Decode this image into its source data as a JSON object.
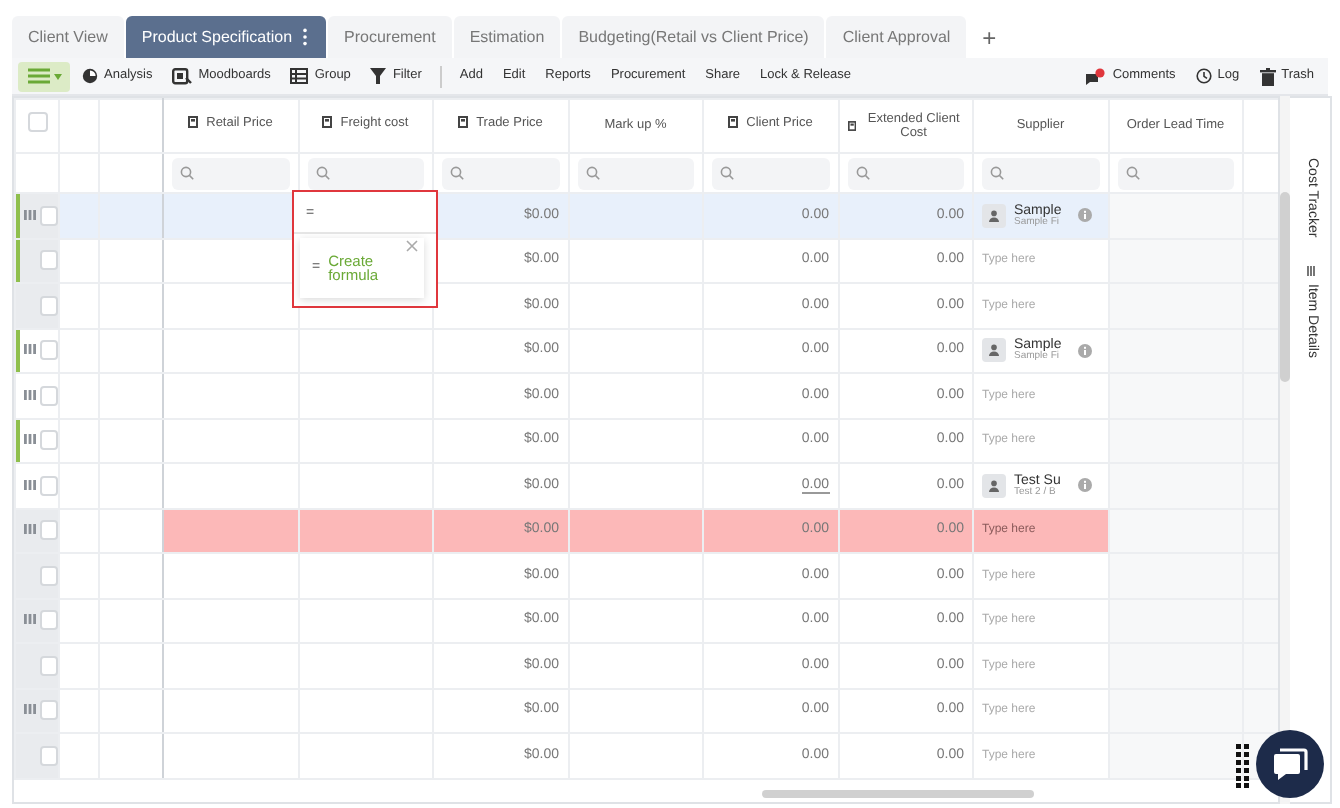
{
  "tabs": [
    {
      "label": "Client View",
      "selected": false,
      "menu": false
    },
    {
      "label": "Product Specification",
      "selected": true,
      "menu": true
    },
    {
      "label": "Procurement",
      "selected": false,
      "menu": false
    },
    {
      "label": "Estimation",
      "selected": false,
      "menu": false
    },
    {
      "label": "Budgeting(Retail vs Client Price)",
      "selected": false,
      "menu": false
    },
    {
      "label": "Client Approval",
      "selected": false,
      "menu": false
    }
  ],
  "add_tab": "+",
  "toolbar": {
    "left": [
      {
        "label": "Analysis",
        "kind": "analysis"
      },
      {
        "label": "Moodboards",
        "kind": "moodboards"
      },
      {
        "label": "Group",
        "kind": "group"
      },
      {
        "label": "Filter",
        "kind": "filter"
      }
    ],
    "actions": [
      "Add",
      "Edit",
      "Reports",
      "Procurement",
      "Share",
      "Lock & Release"
    ],
    "right": [
      {
        "label": "Comments",
        "kind": "comments"
      },
      {
        "label": "Log",
        "kind": "log"
      },
      {
        "label": "Trash",
        "kind": "trash"
      }
    ]
  },
  "select_all": {
    "checked": false
  },
  "columns": [
    {
      "label": "Retail Price",
      "icon": true
    },
    {
      "label": "Freight cost",
      "icon": true
    },
    {
      "label": "Trade Price",
      "icon": true
    },
    {
      "label": "Mark up %",
      "icon": false
    },
    {
      "label": "Client Price",
      "icon": true
    },
    {
      "label": "Extended Client Cost",
      "icon": true
    },
    {
      "label": "Supplier",
      "icon": false
    },
    {
      "label": "Order Lead Time",
      "icon": false
    }
  ],
  "rows": [
    {
      "grip": true,
      "shaded": true,
      "marked": true,
      "selected": true,
      "error": false,
      "trade_price": "$0.00",
      "client_price": "0.00",
      "client_price_underlined": false,
      "extended_cost": "0.00",
      "supplier": {
        "name": "Sample",
        "detail": "Sample Fi"
      }
    },
    {
      "grip": false,
      "shaded": true,
      "marked": true,
      "selected": false,
      "error": false,
      "trade_price": "$0.00",
      "client_price": "0.00",
      "client_price_underlined": false,
      "extended_cost": "0.00",
      "supplier": {
        "placeholder": "Type here"
      }
    },
    {
      "grip": false,
      "shaded": true,
      "marked": false,
      "selected": false,
      "error": false,
      "trade_price": "$0.00",
      "client_price": "0.00",
      "client_price_underlined": false,
      "extended_cost": "0.00",
      "supplier": {
        "placeholder": "Type here"
      }
    },
    {
      "grip": true,
      "shaded": false,
      "marked": true,
      "selected": false,
      "error": false,
      "trade_price": "$0.00",
      "client_price": "0.00",
      "client_price_underlined": false,
      "extended_cost": "0.00",
      "supplier": {
        "name": "Sample",
        "detail": "Sample Fi"
      }
    },
    {
      "grip": true,
      "shaded": false,
      "marked": false,
      "selected": false,
      "error": false,
      "trade_price": "$0.00",
      "client_price": "0.00",
      "client_price_underlined": false,
      "extended_cost": "0.00",
      "supplier": {
        "placeholder": "Type here"
      }
    },
    {
      "grip": true,
      "shaded": false,
      "marked": true,
      "selected": false,
      "error": false,
      "trade_price": "$0.00",
      "client_price": "0.00",
      "client_price_underlined": false,
      "extended_cost": "0.00",
      "supplier": {
        "placeholder": "Type here"
      }
    },
    {
      "grip": true,
      "shaded": false,
      "marked": false,
      "selected": false,
      "error": false,
      "trade_price": "$0.00",
      "client_price": "0.00",
      "client_price_underlined": true,
      "extended_cost": "0.00",
      "supplier": {
        "name": "Test Su",
        "detail": "Test 2 / B"
      }
    },
    {
      "grip": true,
      "shaded": true,
      "marked": false,
      "selected": false,
      "error": true,
      "trade_price": "$0.00",
      "client_price": "0.00",
      "client_price_underlined": false,
      "extended_cost": "0.00",
      "supplier": {
        "placeholder": "Type here"
      }
    },
    {
      "grip": false,
      "shaded": true,
      "marked": false,
      "selected": false,
      "error": false,
      "trade_price": "$0.00",
      "client_price": "0.00",
      "client_price_underlined": false,
      "extended_cost": "0.00",
      "supplier": {
        "placeholder": "Type here"
      }
    },
    {
      "grip": true,
      "shaded": true,
      "marked": false,
      "selected": false,
      "error": false,
      "trade_price": "$0.00",
      "client_price": "0.00",
      "client_price_underlined": false,
      "extended_cost": "0.00",
      "supplier": {
        "placeholder": "Type here"
      }
    },
    {
      "grip": false,
      "shaded": true,
      "marked": false,
      "selected": false,
      "error": false,
      "trade_price": "$0.00",
      "client_price": "0.00",
      "client_price_underlined": false,
      "extended_cost": "0.00",
      "supplier": {
        "placeholder": "Type here"
      }
    },
    {
      "grip": true,
      "shaded": true,
      "marked": false,
      "selected": false,
      "error": false,
      "trade_price": "$0.00",
      "client_price": "0.00",
      "client_price_underlined": false,
      "extended_cost": "0.00",
      "supplier": {
        "placeholder": "Type here"
      }
    },
    {
      "grip": false,
      "shaded": true,
      "marked": false,
      "selected": false,
      "error": false,
      "trade_price": "$0.00",
      "client_price": "0.00",
      "client_price_underlined": false,
      "extended_cost": "0.00",
      "supplier": {
        "placeholder": "Type here"
      }
    }
  ],
  "formula_popup": {
    "value": "=",
    "symbol": "=",
    "option": "Create formula"
  },
  "side_panel": [
    {
      "label": "Cost Tracker",
      "icon": false
    },
    {
      "label": "Item Details",
      "icon": true
    }
  ]
}
